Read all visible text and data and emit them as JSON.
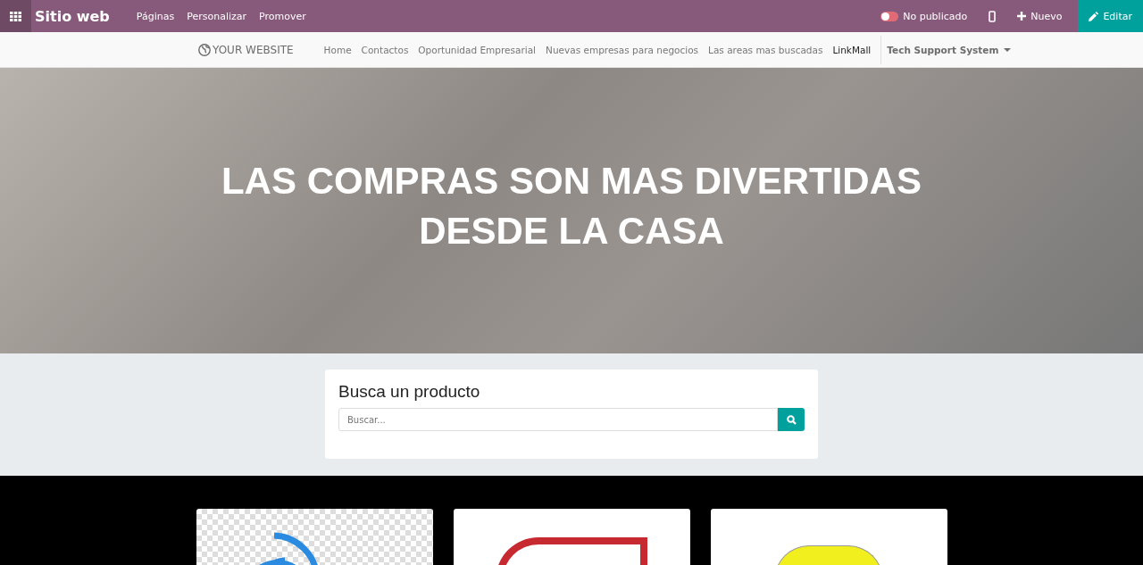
{
  "top_bar": {
    "app_title": "Sitio web",
    "menu": [
      "Páginas",
      "Personalizar",
      "Promover"
    ],
    "publish_toggle": {
      "label": "No publicado",
      "on": false
    },
    "new_button": "Nuevo",
    "edit_button": "Editar"
  },
  "site_nav": {
    "logo": "YOUR WEBSITE",
    "items": [
      {
        "label": "Home",
        "selected": false
      },
      {
        "label": "Contactos",
        "selected": false
      },
      {
        "label": "Oportunidad Empresarial",
        "selected": false
      },
      {
        "label": "Nuevas empresas para negocios",
        "selected": false
      },
      {
        "label": "Las areas mas buscadas",
        "selected": false
      },
      {
        "label": "LinkMall",
        "selected": true
      }
    ],
    "dropdown": "Tech Support System"
  },
  "hero": {
    "heading": "LAS COMPRAS SON MAS DIVERTIDAS DESDE LA CASA"
  },
  "search_card": {
    "title": "Busca un producto",
    "placeholder": "Buscar..."
  },
  "product_cards": [
    {
      "kind": "wifi"
    },
    {
      "kind": "red-logo"
    },
    {
      "kind": "yellow-ball"
    }
  ]
}
